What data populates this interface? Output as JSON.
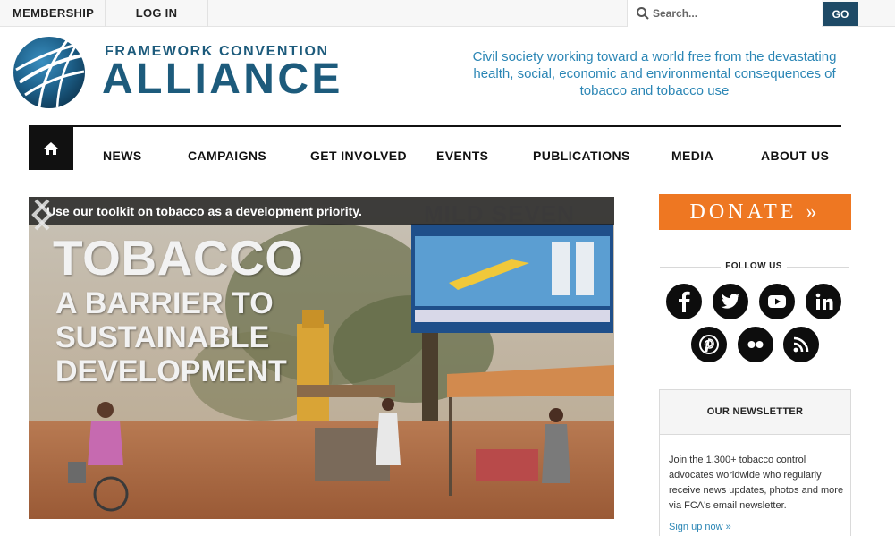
{
  "topbar": {
    "membership": "MEMBERSHIP",
    "login": "LOG IN",
    "search_placeholder": "Search...",
    "go": "GO"
  },
  "header": {
    "logo_line1": "FRAMEWORK CONVENTION",
    "logo_line2": "ALLIANCE",
    "tagline": "Civil society working toward a world free from the devastating health, social, economic and environmental consequences of tobacco and tobacco use"
  },
  "nav": {
    "home_icon": "home-icon",
    "items": [
      "NEWS",
      "CAMPAIGNS",
      "GET INVOLVED",
      "EVENTS",
      "PUBLICATIONS",
      "MEDIA",
      "ABOUT US"
    ]
  },
  "hero": {
    "caption": "Use our toolkit on tobacco as a development priority.",
    "title_line1": "TOBACCO",
    "title_line2": "A BARRIER TO",
    "title_line3": "SUSTAINABLE",
    "title_line4": "DEVELOPMENT",
    "billboard_text": "MILD SEVEN"
  },
  "sidebar": {
    "donate": "DONATE »",
    "follow_us": "FOLLOW US",
    "social_icons": [
      "facebook-icon",
      "twitter-icon",
      "youtube-icon",
      "linkedin-icon",
      "pinterest-icon",
      "flickr-icon",
      "rss-icon"
    ],
    "newsletter_title": "OUR NEWSLETTER",
    "newsletter_body": "Join the 1,300+ tobacco control advocates worldwide who regularly receive news updates, photos and more via FCA's email newsletter.",
    "newsletter_link": "Sign up now »"
  },
  "colors": {
    "brand_blue": "#1d5b7c",
    "tagline_blue": "#2b86b5",
    "donate_orange": "#ee7722",
    "go_button": "#1e4a66"
  }
}
